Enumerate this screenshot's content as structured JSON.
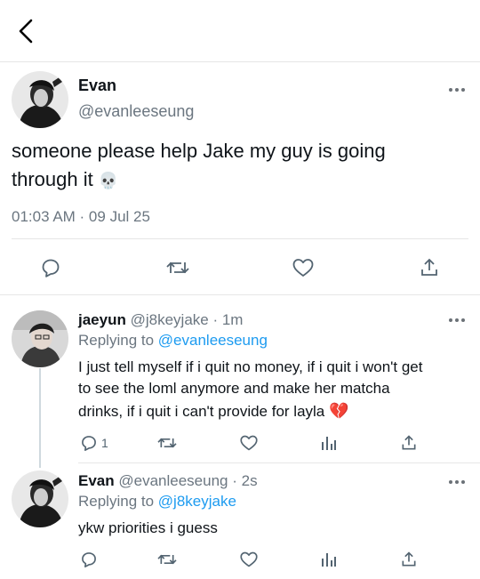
{
  "header": {
    "back_icon": "chevron-left-icon"
  },
  "main_tweet": {
    "name": "Evan",
    "handle": "@evanleeseung",
    "text": "someone please help Jake my guy is going through it",
    "emoji": "💀",
    "timestamp": "01:03 AM · 09 Jul 25",
    "actions": [
      "reply-icon",
      "retweet-icon",
      "like-icon",
      "share-icon"
    ]
  },
  "replies": [
    {
      "name": "jaeyun",
      "handle": "@j8keyjake",
      "time": "· 1m",
      "replying_prefix": "Replying to",
      "replying_to": "@evanleeseung",
      "line1": "I just tell myself if i quit no money, if i quit i won't get",
      "line2": "to see the loml anymore and make her matcha",
      "line3": "drinks, if i quit i can't provide for layla",
      "emoji": "💔",
      "reply_count": "1"
    },
    {
      "name": "Evan",
      "handle": "@evanleeseung",
      "time": "· 2s",
      "replying_prefix": "Replying to",
      "replying_to": "@j8keyjake",
      "text": "ykw priorities i guess"
    }
  ],
  "colors": {
    "link": "#1d9bf0",
    "muted": "#6b7680",
    "text": "#0f1419",
    "icon": "#536471"
  }
}
